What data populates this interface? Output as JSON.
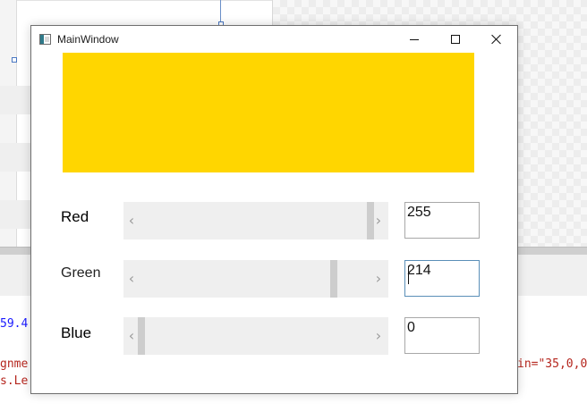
{
  "window": {
    "title": "MainWindow"
  },
  "preview": {
    "color": "#FFD600"
  },
  "channels": [
    {
      "id": "red",
      "label": "Red",
      "value": "255",
      "max": 255
    },
    {
      "id": "green",
      "label": "Green",
      "value": "214",
      "max": 255
    },
    {
      "id": "blue",
      "label": "Blue",
      "value": "0",
      "max": 255
    }
  ],
  "scroll_arrows": {
    "left": "‹",
    "right": "›"
  },
  "background_code": {
    "line1": "59.4",
    "line2_left": "gnme",
    "line2_right": "in=\"35,0,0",
    "line3": "s.Le"
  }
}
